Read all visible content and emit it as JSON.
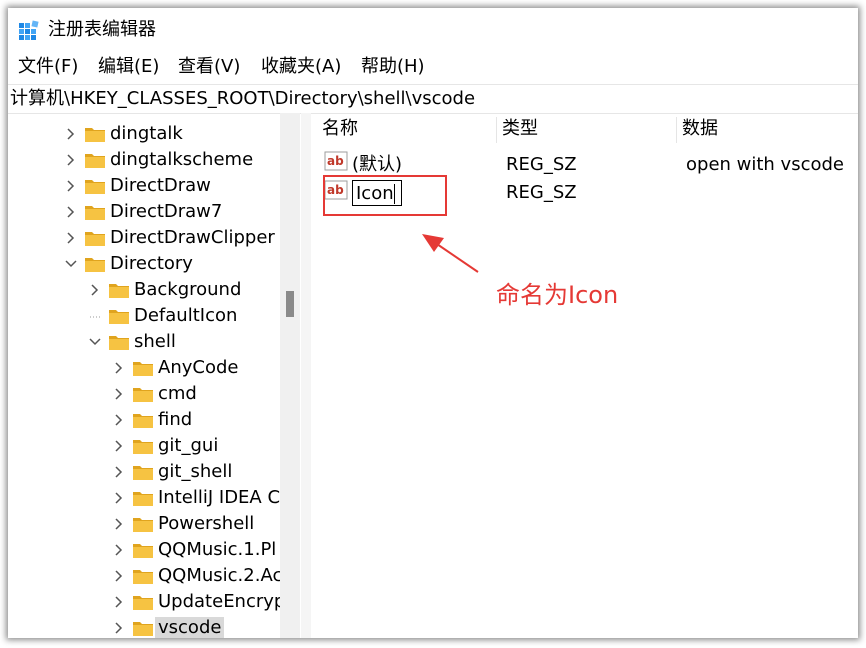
{
  "window": {
    "title": "注册表编辑器"
  },
  "menu": [
    "文件(F)",
    "编辑(E)",
    "查看(V)",
    "收藏夹(A)",
    "帮助(H)"
  ],
  "address": "计算机\\HKEY_CLASSES_ROOT\\Directory\\shell\\vscode",
  "tree": [
    {
      "label": "dingtalk",
      "level": 0,
      "expander": "collapsed"
    },
    {
      "label": "dingtalkscheme",
      "level": 0,
      "expander": "collapsed"
    },
    {
      "label": "DirectDraw",
      "level": 0,
      "expander": "collapsed"
    },
    {
      "label": "DirectDraw7",
      "level": 0,
      "expander": "collapsed"
    },
    {
      "label": "DirectDrawClipper",
      "level": 0,
      "expander": "collapsed"
    },
    {
      "label": "Directory",
      "level": 0,
      "expander": "expanded"
    },
    {
      "label": "Background",
      "level": 1,
      "expander": "collapsed"
    },
    {
      "label": "DefaultIcon",
      "level": 1,
      "expander": "none"
    },
    {
      "label": "shell",
      "level": 1,
      "expander": "expanded"
    },
    {
      "label": "AnyCode",
      "level": 2,
      "expander": "collapsed"
    },
    {
      "label": "cmd",
      "level": 2,
      "expander": "collapsed"
    },
    {
      "label": "find",
      "level": 2,
      "expander": "collapsed"
    },
    {
      "label": "git_gui",
      "level": 2,
      "expander": "collapsed"
    },
    {
      "label": "git_shell",
      "level": 2,
      "expander": "collapsed"
    },
    {
      "label": "IntelliJ IDEA C",
      "level": 2,
      "expander": "collapsed"
    },
    {
      "label": "Powershell",
      "level": 2,
      "expander": "collapsed"
    },
    {
      "label": "QQMusic.1.Pl",
      "level": 2,
      "expander": "collapsed"
    },
    {
      "label": "QQMusic.2.Ac",
      "level": 2,
      "expander": "collapsed"
    },
    {
      "label": "UpdateEncryp",
      "level": 2,
      "expander": "collapsed"
    },
    {
      "label": "vscode",
      "level": 2,
      "expander": "collapsed",
      "selected": true
    }
  ],
  "list": {
    "columns": [
      "名称",
      "类型",
      "数据"
    ],
    "rows": [
      {
        "name": "(默认)",
        "type": "REG_SZ",
        "data": "open with vscode"
      },
      {
        "name": "Icon",
        "type": "REG_SZ",
        "data": "",
        "editing": true
      }
    ]
  },
  "annotation": {
    "text": "命名为Icon",
    "color": "#e53935"
  },
  "colors": {
    "folder": "#f6c342",
    "folder_dark": "#e0a41e",
    "selection": "#d9d9d9",
    "ab_red": "#c0392b"
  }
}
